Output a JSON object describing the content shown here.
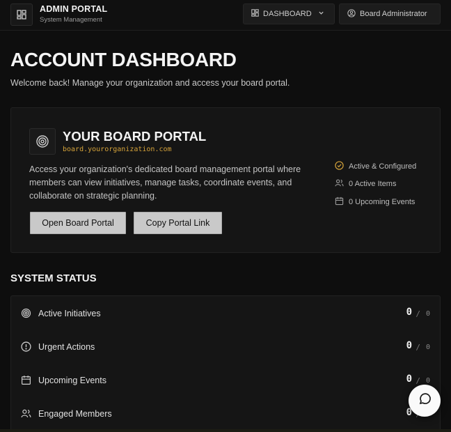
{
  "header": {
    "brand_title": "ADMIN PORTAL",
    "brand_subtitle": "System Management",
    "nav_dashboard": "DASHBOARD",
    "nav_user": "Board Administrator"
  },
  "page": {
    "title": "ACCOUNT DASHBOARD",
    "subtitle": "Welcome back! Manage your organization and access your board portal."
  },
  "portal": {
    "title": "YOUR BOARD PORTAL",
    "url": "board.yourorganization.com",
    "description": "Access your organization's dedicated board management portal where members can view initiatives, manage tasks, coordinate events, and collaborate on strategic planning.",
    "open_button": "Open Board Portal",
    "copy_button": "Copy Portal Link",
    "status": [
      {
        "label": "Active & Configured",
        "icon": "check-circle-icon"
      },
      {
        "label": "0 Active Items",
        "icon": "users-icon"
      },
      {
        "label": "0 Upcoming Events",
        "icon": "calendar-icon"
      }
    ]
  },
  "system_status": {
    "title": "SYSTEM STATUS",
    "rows": [
      {
        "label": "Active Initiatives",
        "value": "0",
        "slash": "/",
        "total": "0",
        "icon": "target-icon"
      },
      {
        "label": "Urgent Actions",
        "value": "0",
        "slash": "/",
        "total": "0",
        "icon": "alert-circle-icon"
      },
      {
        "label": "Upcoming Events",
        "value": "0",
        "slash": "/",
        "total": "0",
        "icon": "calendar-icon"
      },
      {
        "label": "Engaged Members",
        "value": "0",
        "slash": "/",
        "total": "0",
        "icon": "users-icon"
      }
    ]
  },
  "colors": {
    "background": "#0e0e0e",
    "card": "#151515",
    "accent_url": "#d4a23a",
    "success": "#d4a23a",
    "button": "#c9c9c9"
  }
}
